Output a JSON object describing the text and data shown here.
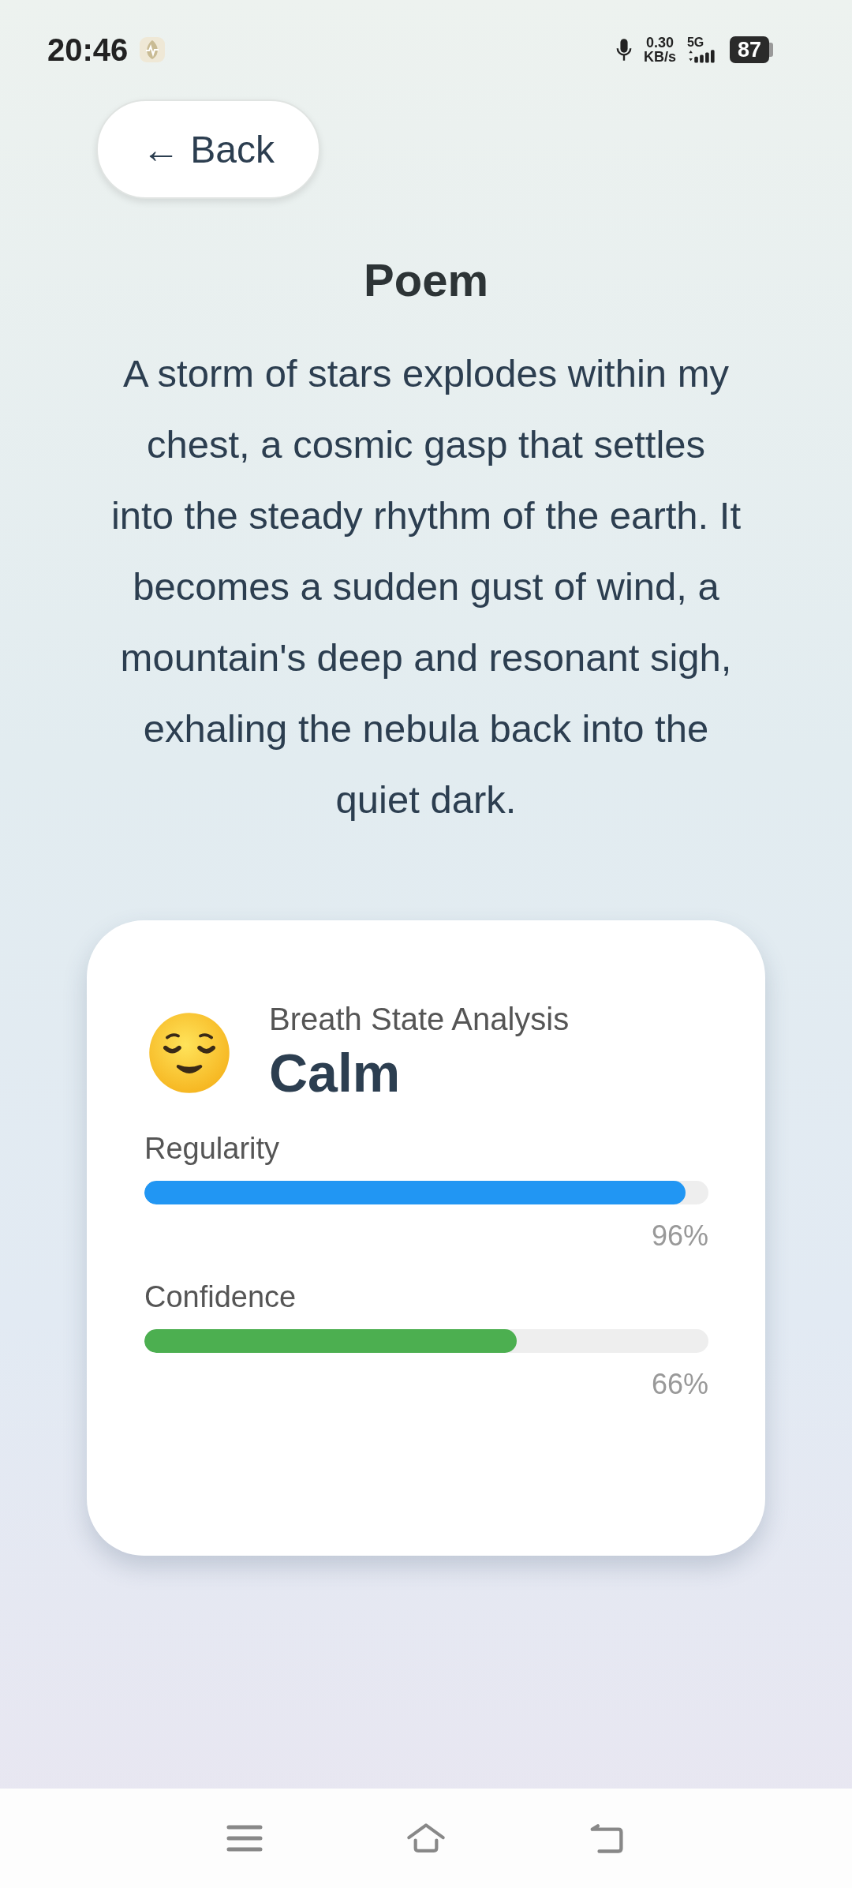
{
  "status_bar": {
    "time": "20:46",
    "net_speed": "0.30",
    "net_unit": "KB/s",
    "network": "5G",
    "battery": "87"
  },
  "back_button": {
    "label": "← Back"
  },
  "poem": {
    "title": "Poem",
    "text": "A storm of stars explodes within my chest, a cosmic gasp that settles into the steady rhythm of the earth. It becomes a sudden gust of wind, a mountain's deep and resonant sigh, exhaling the nebula back into the quiet dark."
  },
  "analysis": {
    "heading": "Breath State Analysis",
    "state": "Calm",
    "metrics": [
      {
        "label": "Regularity",
        "level": 0.96,
        "reading": "96%",
        "color": "#2196f3"
      },
      {
        "label": "Confidence",
        "level": 0.66,
        "reading": "66%",
        "color": "#4caf50"
      }
    ]
  }
}
